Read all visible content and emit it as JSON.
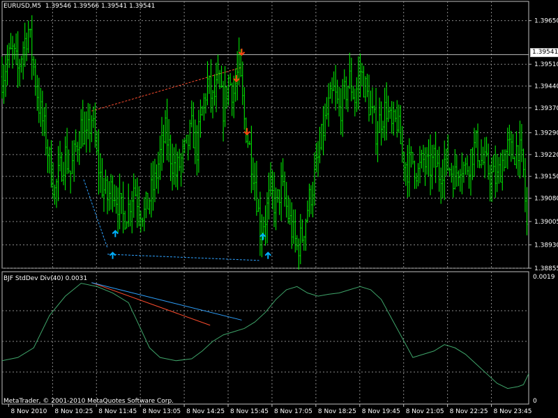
{
  "header": {
    "symbol_label": "EURUSD,M5",
    "ohlc_label": "1.39546 1.39566 1.39541 1.39541"
  },
  "indicator": {
    "label": "BJF StdDev Div(40) 0.0031",
    "axis_top_label": "0.0019",
    "axis_bottom_label": "0"
  },
  "footer": {
    "copyright": "MetaTrader, © 2001-2010 MetaQuotes Software Corp."
  },
  "current_price_label": "1.39541",
  "colors": {
    "background": "#000000",
    "grid": "#8a8a8a",
    "candles": "#00ff00",
    "indicator_line": "#3fa56a",
    "arrow_up": "#00b0ff",
    "arrow_down": "#ff4010",
    "div_red": "#ff4d2e",
    "div_blue": "#2ea2ff",
    "text": "#ffffff"
  },
  "chart_data": [
    {
      "type": "candlestick",
      "title": "EURUSD,M5",
      "y_ticks": [
        "1.39650",
        "1.39510",
        "1.39440",
        "1.39370",
        "1.39290",
        "1.39220",
        "1.39150",
        "1.39080",
        "1.39005",
        "1.38930",
        "1.38855"
      ],
      "ylim": [
        1.38855,
        1.39685
      ],
      "x_ticks": [
        "8 Nov 2010",
        "8 Nov 10:25",
        "8 Nov 11:45",
        "8 Nov 13:05",
        "8 Nov 14:25",
        "8 Nov 15:45",
        "8 Nov 17:05",
        "8 Nov 18:25",
        "8 Nov 19:45",
        "8 Nov 21:05",
        "8 Nov 22:25",
        "8 Nov 23:45"
      ],
      "current_price": 1.39541,
      "price_path": [
        [
          0,
          1.3947
        ],
        [
          1,
          1.3952
        ],
        [
          2,
          1.3955
        ],
        [
          3,
          1.3949
        ],
        [
          4,
          1.3957
        ],
        [
          5,
          1.3962
        ],
        [
          6,
          1.395
        ],
        [
          7,
          1.3938
        ],
        [
          8,
          1.393
        ],
        [
          9,
          1.392
        ],
        [
          10,
          1.391
        ],
        [
          11,
          1.3917
        ],
        [
          12,
          1.3922
        ],
        [
          13,
          1.3916
        ],
        [
          14,
          1.3924
        ],
        [
          15,
          1.3931
        ],
        [
          16,
          1.3926
        ],
        [
          17,
          1.3934
        ],
        [
          18,
          1.3921
        ],
        [
          19,
          1.3912
        ],
        [
          20,
          1.3908
        ],
        [
          21,
          1.3912
        ],
        [
          22,
          1.3907
        ],
        [
          23,
          1.3902
        ],
        [
          24,
          1.3905
        ],
        [
          25,
          1.3912
        ],
        [
          26,
          1.3906
        ],
        [
          27,
          1.3903
        ],
        [
          28,
          1.3908
        ],
        [
          29,
          1.3913
        ],
        [
          30,
          1.3922
        ],
        [
          31,
          1.3929
        ],
        [
          32,
          1.3922
        ],
        [
          33,
          1.3916
        ],
        [
          34,
          1.392
        ],
        [
          35,
          1.3924
        ],
        [
          36,
          1.393
        ],
        [
          37,
          1.3924
        ],
        [
          38,
          1.3936
        ],
        [
          39,
          1.3945
        ],
        [
          40,
          1.3939
        ],
        [
          41,
          1.3944
        ],
        [
          42,
          1.3937
        ],
        [
          43,
          1.3946
        ],
        [
          44,
          1.3942
        ],
        [
          45,
          1.395
        ],
        [
          46,
          1.3933
        ],
        [
          47,
          1.3924
        ],
        [
          48,
          1.3914
        ],
        [
          49,
          1.3898
        ],
        [
          50,
          1.3902
        ],
        [
          51,
          1.391
        ],
        [
          52,
          1.3905
        ],
        [
          53,
          1.3912
        ],
        [
          54,
          1.3905
        ],
        [
          55,
          1.3898
        ],
        [
          56,
          1.3892
        ],
        [
          57,
          1.3896
        ],
        [
          58,
          1.3905
        ],
        [
          59,
          1.3912
        ],
        [
          60,
          1.392
        ],
        [
          61,
          1.393
        ],
        [
          62,
          1.3937
        ],
        [
          63,
          1.3942
        ],
        [
          64,
          1.3936
        ],
        [
          65,
          1.3941
        ],
        [
          66,
          1.3946
        ],
        [
          67,
          1.394
        ],
        [
          68,
          1.3949
        ],
        [
          69,
          1.3943
        ],
        [
          70,
          1.3936
        ],
        [
          71,
          1.393
        ],
        [
          72,
          1.3934
        ],
        [
          73,
          1.3937
        ],
        [
          74,
          1.393
        ],
        [
          75,
          1.3933
        ],
        [
          76,
          1.3922
        ],
        [
          77,
          1.3918
        ],
        [
          78,
          1.392
        ],
        [
          79,
          1.3916
        ],
        [
          80,
          1.392
        ],
        [
          81,
          1.3917
        ],
        [
          82,
          1.392
        ],
        [
          83,
          1.3916
        ],
        [
          84,
          1.392
        ],
        [
          85,
          1.3918
        ],
        [
          86,
          1.3915
        ],
        [
          87,
          1.392
        ],
        [
          88,
          1.3917
        ],
        [
          89,
          1.3922
        ],
        [
          90,
          1.3925
        ],
        [
          91,
          1.392
        ],
        [
          92,
          1.3918
        ],
        [
          93,
          1.3915
        ],
        [
          94,
          1.3914
        ],
        [
          95,
          1.392
        ],
        [
          96,
          1.3924
        ],
        [
          97,
          1.3922
        ],
        [
          98,
          1.3925
        ],
        [
          99,
          1.3916
        ],
        [
          100,
          1.389
        ]
      ],
      "arrows": [
        {
          "kind": "down",
          "bar": 45.5,
          "price": 1.3954
        },
        {
          "kind": "down",
          "bar": 44.5,
          "price": 1.39455
        },
        {
          "kind": "down",
          "bar": 46.5,
          "price": 1.39285
        },
        {
          "kind": "up",
          "bar": 21.5,
          "price": 1.38975
        },
        {
          "kind": "up",
          "bar": 21.0,
          "price": 1.38905
        },
        {
          "kind": "up",
          "bar": 49.5,
          "price": 1.38965
        },
        {
          "kind": "up",
          "bar": 50.5,
          "price": 1.38905
        }
      ],
      "divergence_lines": [
        {
          "color": "red",
          "dashed": true,
          "from": [
            17,
            1.3936
          ],
          "to": [
            45.5,
            1.395
          ]
        },
        {
          "color": "blue",
          "dashed": true,
          "from": [
            15.5,
            1.3914
          ],
          "to": [
            20,
            1.3892
          ]
        },
        {
          "color": "blue",
          "dashed": true,
          "from": [
            20,
            1.389
          ],
          "to": [
            48.8,
            1.3888
          ]
        }
      ]
    },
    {
      "type": "line",
      "title": "BJF StdDev Div(40) 0.0031",
      "ylim": [
        0,
        0.0019
      ],
      "series": [
        {
          "values": [
            [
              0,
              0.00065
            ],
            [
              3,
              0.0007
            ],
            [
              6,
              0.00085
            ],
            [
              9,
              0.00135
            ],
            [
              12,
              0.00165
            ],
            [
              15,
              0.00185
            ],
            [
              18,
              0.0018
            ],
            [
              21,
              0.0017
            ],
            [
              24,
              0.00155
            ],
            [
              26,
              0.0012
            ],
            [
              28,
              0.00085
            ],
            [
              30,
              0.0007
            ],
            [
              33,
              0.00065
            ],
            [
              36,
              0.00068
            ],
            [
              38,
              0.0008
            ],
            [
              40,
              0.00095
            ],
            [
              42,
              0.00105
            ],
            [
              44,
              0.0011
            ],
            [
              46,
              0.00115
            ],
            [
              48,
              0.00125
            ],
            [
              50,
              0.0014
            ],
            [
              52,
              0.0016
            ],
            [
              54,
              0.00175
            ],
            [
              56,
              0.0018
            ],
            [
              58,
              0.0017
            ],
            [
              60,
              0.00165
            ],
            [
              62,
              0.00168
            ],
            [
              64,
              0.0017
            ],
            [
              66,
              0.00175
            ],
            [
              68,
              0.0018
            ],
            [
              70,
              0.00175
            ],
            [
              72,
              0.0016
            ],
            [
              74,
              0.0013
            ],
            [
              76,
              0.001
            ],
            [
              78,
              0.0007
            ],
            [
              80,
              0.00075
            ],
            [
              82,
              0.0008
            ],
            [
              84,
              0.0009
            ],
            [
              86,
              0.00085
            ],
            [
              88,
              0.00075
            ],
            [
              90,
              0.0006
            ],
            [
              92,
              0.00045
            ],
            [
              94,
              0.0003
            ],
            [
              96,
              0.00022
            ],
            [
              98,
              0.00025
            ],
            [
              99,
              0.00028
            ],
            [
              100,
              0.00045
            ]
          ]
        }
      ],
      "divergence_lines": [
        {
          "color": "red",
          "from": [
            17,
            0.00186
          ],
          "to": [
            39.5,
            0.0012
          ]
        },
        {
          "color": "blue",
          "from": [
            17,
            0.00186
          ],
          "to": [
            45.5,
            0.00128
          ]
        }
      ]
    }
  ]
}
